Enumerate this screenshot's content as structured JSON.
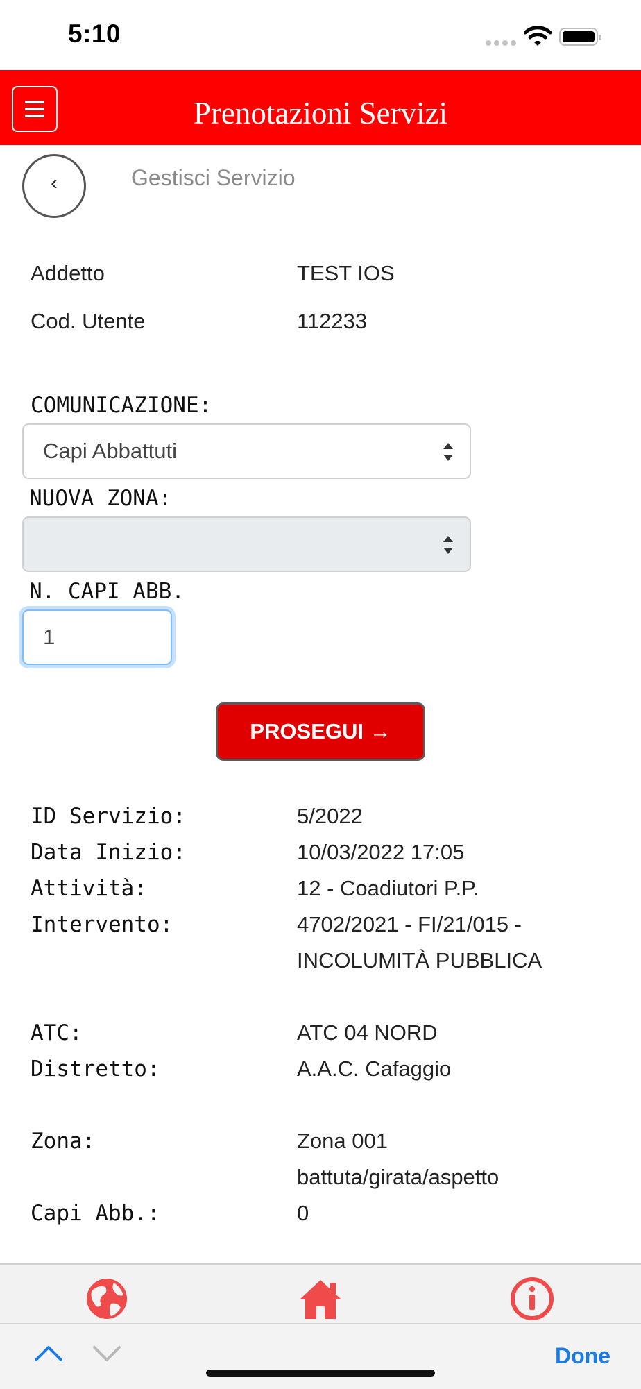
{
  "status_bar": {
    "time": "5:10"
  },
  "header": {
    "title": "Prenotazioni Servizi"
  },
  "page": {
    "subtitle": "Gestisci Servizio",
    "back_label": "‹"
  },
  "user_info": [
    {
      "label": "Addetto",
      "value": "TEST IOS"
    },
    {
      "label": "Cod. Utente",
      "value": "112233"
    }
  ],
  "form": {
    "comunicazione_label": "COMUNICAZIONE:",
    "comunicazione_value": "Capi Abbattuti",
    "nuova_zona_label": "NUOVA ZONA:",
    "nuova_zona_value": "",
    "capi_label": "N. CAPI ABB.",
    "capi_value": "1",
    "proceed_label": "PROSEGUI →"
  },
  "details": [
    {
      "label": "ID Servizio:",
      "value": "5/2022"
    },
    {
      "label": "Data Inizio:",
      "value": "10/03/2022 17:05"
    },
    {
      "label": "Attività:",
      "value": "12 - Coadiutori P.P."
    },
    {
      "label": "Intervento:",
      "value": "4702/2021 - FI/21/015 -",
      "value2": "INCOLUMITÀ PUBBLICA"
    },
    {
      "label": "ATC:",
      "value": "ATC 04 NORD"
    },
    {
      "label": "Distretto:",
      "value": "A.A.C. Cafaggio"
    },
    {
      "label": "Zona:",
      "value": "Zona 001",
      "value2": "battuta/girata/aspetto"
    },
    {
      "label": "Capi Abb.:",
      "value": "0"
    }
  ],
  "tabbar": {
    "icons": [
      "globe-icon",
      "home-icon",
      "info-icon"
    ],
    "accent": "#f04b4b"
  },
  "keyboard_accessory": {
    "done_label": "Done",
    "done_color": "#1a7be6"
  },
  "colors": {
    "header": "#fe0000",
    "button": "#e00000"
  }
}
